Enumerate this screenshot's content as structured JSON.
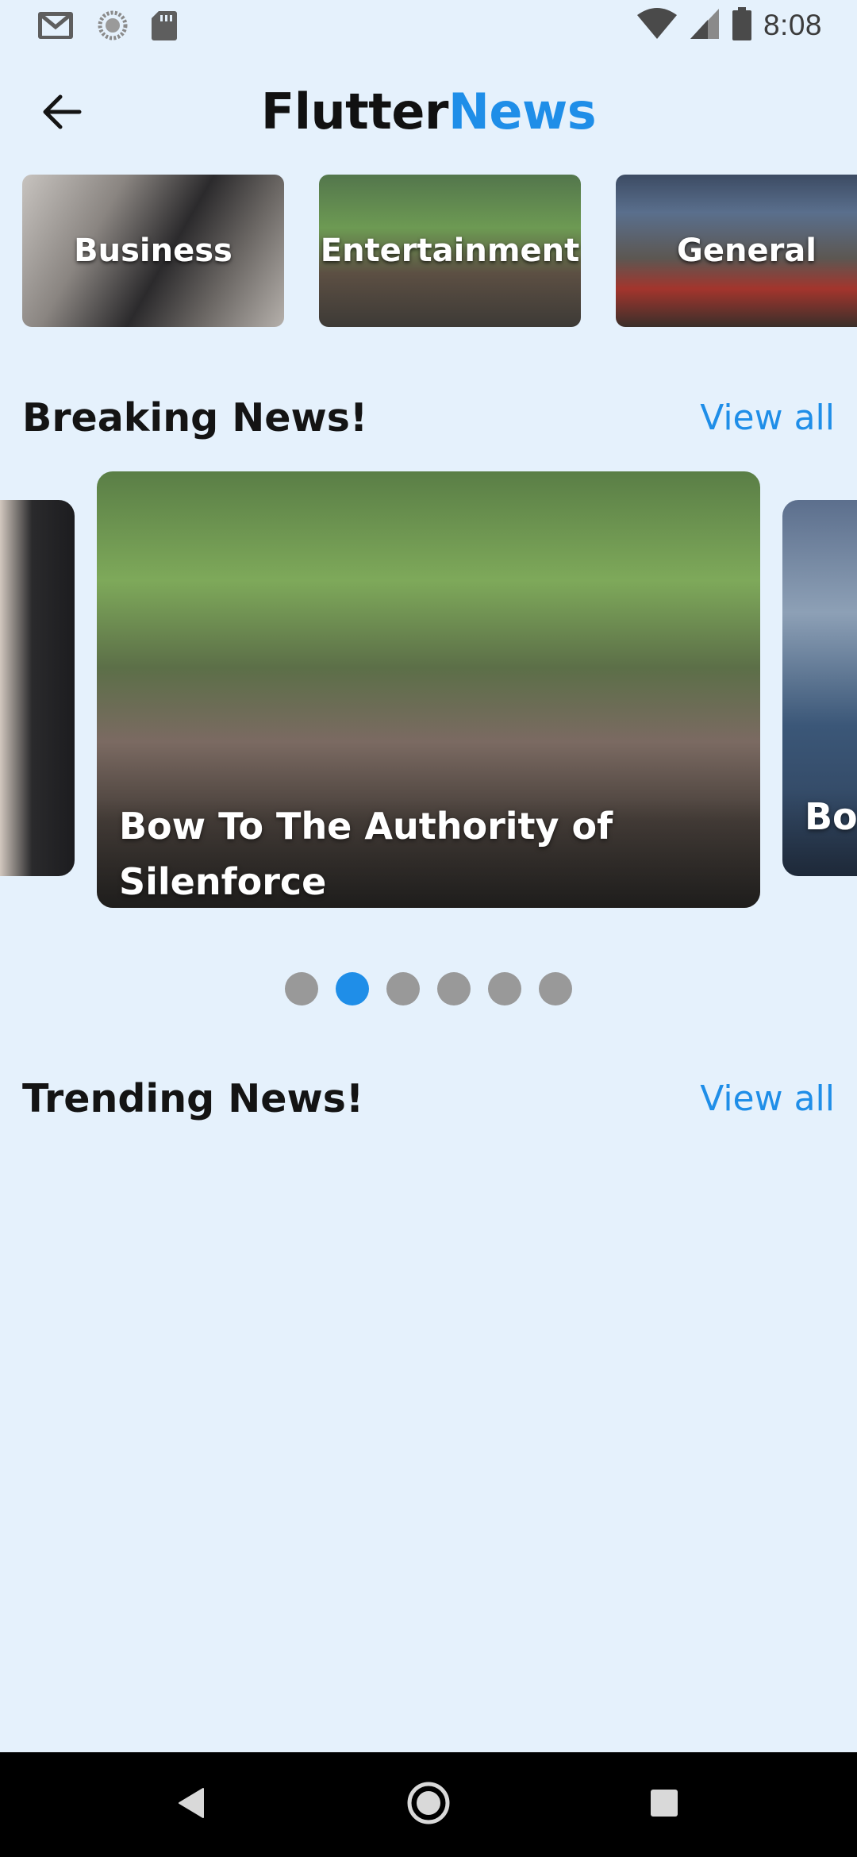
{
  "status_bar": {
    "time": "8:08",
    "left_icons": [
      "gmail-icon",
      "sync-icon",
      "sd-card-icon"
    ],
    "right_icons": [
      "wifi-icon",
      "cell-signal-icon",
      "battery-icon"
    ]
  },
  "app_bar": {
    "title_part1": "Flutter",
    "title_part2": "News",
    "back_icon": "arrow-left-icon"
  },
  "categories": [
    {
      "label": "Business"
    },
    {
      "label": "Entertainment"
    },
    {
      "label": "General"
    }
  ],
  "breaking": {
    "title": "Breaking News!",
    "view_all": "View all",
    "slides": [
      {
        "title": ""
      },
      {
        "title": "Bow To The Authority of Silenforce"
      },
      {
        "title": "Bow"
      }
    ],
    "pager": {
      "count": 6,
      "active_index": 1
    }
  },
  "trending": {
    "title": "Trending News!",
    "view_all": "View all"
  },
  "colors": {
    "background": "#e5f1fc",
    "accent": "#1f8ee8",
    "dot_inactive": "#999999"
  },
  "nav_bar": {
    "icons": [
      "back-triangle-icon",
      "home-circle-icon",
      "recents-square-icon"
    ]
  }
}
